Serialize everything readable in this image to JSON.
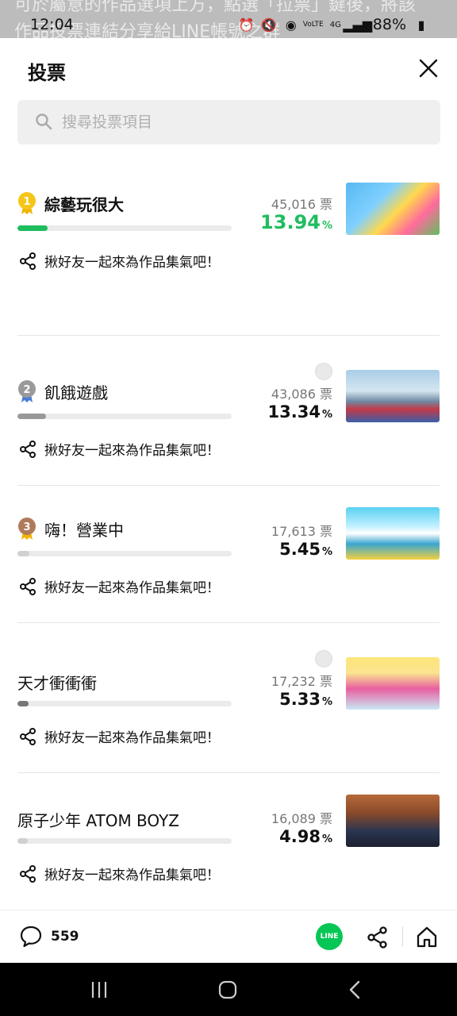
{
  "status_bar": {
    "time": "12:04",
    "battery": "88%",
    "background_text_line1": "可於屬意的作品選項上方，點選「拉票」鍵後，將該",
    "background_text_line2": "作品投票連結分享給LINE帳號之群"
  },
  "header": {
    "title": "投票"
  },
  "search": {
    "placeholder": "搜尋投票項目"
  },
  "share_text": "揪好友一起來為作品集氣吧！",
  "items": [
    {
      "rank": "1",
      "name": "綜藝玩很大",
      "votes": "45,016 票",
      "percent": "13.94",
      "unit": "%",
      "progress": 0.1394,
      "bar_color": "#1fbd5e",
      "rank_color": "#f5c518"
    },
    {
      "rank": "2",
      "name": "飢餓遊戲",
      "votes": "43,086 票",
      "percent": "13.34",
      "unit": "%",
      "progress": 0.1334,
      "bar_color": "#999999",
      "rank_color": "#9a9a9a"
    },
    {
      "rank": "3",
      "name": "嗨！營業中",
      "votes": "17,613 票",
      "percent": "5.45",
      "unit": "%",
      "progress": 0.0545,
      "bar_color": "#d0d0d0",
      "rank_color": "#b07a5a"
    },
    {
      "rank": "",
      "name": "天才衝衝衝",
      "votes": "17,232 票",
      "percent": "5.33",
      "unit": "%",
      "progress": 0.0533,
      "bar_color": "#777777"
    },
    {
      "rank": "",
      "name": "原子少年 ATOM BOYZ",
      "votes": "16,089 票",
      "percent": "4.98",
      "unit": "%",
      "progress": 0.0498,
      "bar_color": "#d0d0d0"
    }
  ],
  "bottom_bar": {
    "comment_count": "559",
    "line_label": "LINE"
  },
  "colors": {
    "accent_green": "#1fbd5e",
    "line_green": "#06c755"
  }
}
